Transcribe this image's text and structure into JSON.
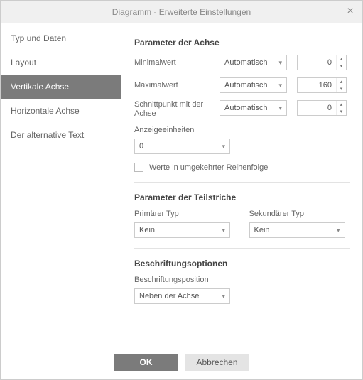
{
  "title": "Diagramm - Erweiterte Einstellungen",
  "sidebar": {
    "items": [
      {
        "label": "Typ und Daten"
      },
      {
        "label": "Layout"
      },
      {
        "label": "Vertikale Achse"
      },
      {
        "label": "Horizontale Achse"
      },
      {
        "label": "Der alternative Text"
      }
    ],
    "active_index": 2
  },
  "axis": {
    "section_title": "Parameter der Achse",
    "min_label": "Minimalwert",
    "min_mode": "Automatisch",
    "min_value": "0",
    "max_label": "Maximalwert",
    "max_mode": "Automatisch",
    "max_value": "160",
    "cross_label": "Schnittpunkt mit der Achse",
    "cross_mode": "Automatisch",
    "cross_value": "0",
    "units_label": "Anzeigeeinheiten",
    "units_value": "0",
    "reverse_label": "Werte in umgekehrter Reihenfolge"
  },
  "ticks": {
    "section_title": "Parameter der Teilstriche",
    "primary_label": "Primärer Typ",
    "primary_value": "Kein",
    "secondary_label": "Sekundärer Typ",
    "secondary_value": "Kein"
  },
  "labels": {
    "section_title": "Beschriftungsoptionen",
    "pos_label": "Beschriftungsposition",
    "pos_value": "Neben der Achse"
  },
  "buttons": {
    "ok": "OK",
    "cancel": "Abbrechen"
  }
}
